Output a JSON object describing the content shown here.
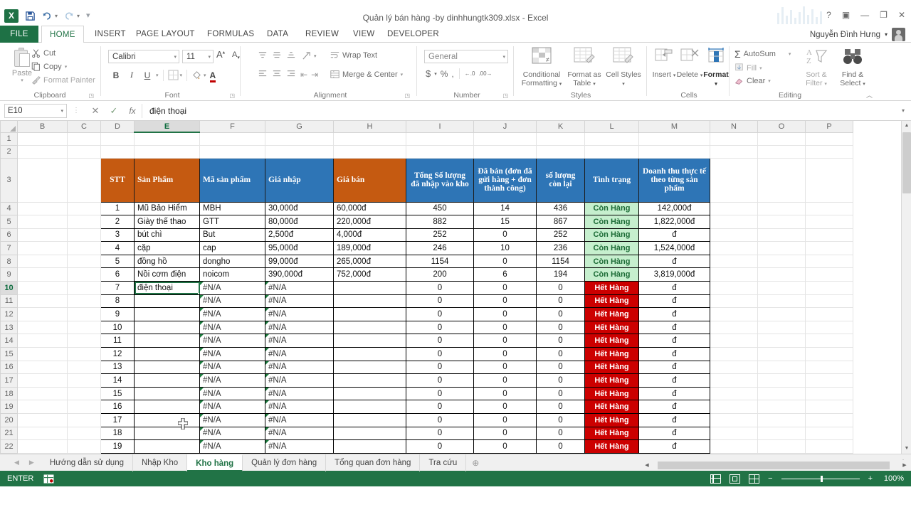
{
  "window": {
    "title": "Quản lý bán hàng -by dinhhungtk309.xlsx - Excel",
    "help": "?",
    "ribbon_display": "▣",
    "minimize": "—",
    "restore": "❐",
    "close": "✕",
    "user_name": "Nguyễn Đình Hưng",
    "user_caret": "▾"
  },
  "qat": {
    "save": "💾",
    "undo": "↰",
    "redo": "↱",
    "more": "▾"
  },
  "ribbon_tabs": [
    {
      "label": "FILE"
    },
    {
      "label": "HOME"
    },
    {
      "label": "INSERT"
    },
    {
      "label": "PAGE LAYOUT"
    },
    {
      "label": "FORMULAS"
    },
    {
      "label": "DATA"
    },
    {
      "label": "REVIEW"
    },
    {
      "label": "VIEW"
    },
    {
      "label": "DEVELOPER"
    }
  ],
  "ribbon": {
    "clipboard": {
      "group_label": "Clipboard",
      "paste": "Paste",
      "paste_caret": "▾",
      "cut": "Cut",
      "copy": "Copy",
      "copy_caret": "▾",
      "format_painter": "Format Painter"
    },
    "font": {
      "group_label": "Font",
      "font_name": "Calibri",
      "font_size": "11",
      "grow": "A",
      "shrink": "A",
      "bold": "B",
      "italic": "I",
      "underline": "U",
      "borders": "▦",
      "fill_color": "◔",
      "font_color": "A",
      "caret": "▾"
    },
    "alignment": {
      "group_label": "Alignment",
      "wrap_text": "Wrap Text",
      "merge_center": "Merge & Center",
      "merge_caret": "▾",
      "orientation": "↗",
      "decrease_indent": "⇤",
      "increase_indent": "⇥"
    },
    "number": {
      "group_label": "Number",
      "format": "General",
      "currency": "$",
      "percent": "%",
      "comma": ",",
      "increase_decimal": "←.0",
      "decrease_decimal": ".00→",
      "caret": "▾"
    },
    "styles": {
      "group_label": "Styles",
      "conditional_formatting": "Conditional Formatting",
      "format_as_table": "Format as Table",
      "cell_styles": "Cell Styles",
      "caret": "▾"
    },
    "cells": {
      "group_label": "Cells",
      "insert": "Insert",
      "delete": "Delete",
      "format": "Format",
      "caret": "▾"
    },
    "editing": {
      "group_label": "Editing",
      "autosum": "AutoSum",
      "fill": "Fill",
      "clear": "Clear",
      "sort_filter": "Sort & Filter",
      "find_select": "Find & Select",
      "caret": "▾",
      "collapse": "︿"
    }
  },
  "formula_bar": {
    "name_box": "E10",
    "name_caret": "▾",
    "cancel": "✕",
    "enter": "✓",
    "fx": "fx",
    "value": "điện thoại",
    "expand": "▾"
  },
  "grid": {
    "columns": [
      "B",
      "C",
      "D",
      "E",
      "F",
      "G",
      "H",
      "I",
      "J",
      "K",
      "L",
      "M",
      "N",
      "O",
      "P"
    ],
    "selected_column": "E",
    "selected_row": "10",
    "rows": [
      "1",
      "2",
      "3",
      "4",
      "5",
      "6",
      "7",
      "8",
      "9",
      "10",
      "11",
      "12",
      "13",
      "14",
      "15",
      "16",
      "17",
      "18",
      "19",
      "20",
      "21",
      "22"
    ],
    "table_headers": [
      {
        "text": "STT",
        "color": "orange",
        "align": "ctr"
      },
      {
        "text": "Sản Phẩm",
        "color": "orange",
        "align": "left"
      },
      {
        "text": "Mã sản phẩm",
        "color": "blue",
        "align": "left"
      },
      {
        "text": "Giá nhập",
        "color": "blue",
        "align": "left"
      },
      {
        "text": "Giá bán",
        "color": "orange",
        "align": "left"
      },
      {
        "text": "Tổng Số lượng đã nhập vào kho",
        "color": "blue",
        "align": "ctr"
      },
      {
        "text": "Đã bán (đơn đã gửi hàng + đơn thành công)",
        "color": "blue",
        "align": "ctr"
      },
      {
        "text": "số lượng còn lại",
        "color": "blue",
        "align": "ctr"
      },
      {
        "text": "Tình trạng",
        "color": "blue",
        "align": "ctr"
      },
      {
        "text": "Doanh thu thực tế theo từng sản phẩm",
        "color": "blue",
        "align": "ctr"
      }
    ],
    "table_rows": [
      {
        "stt": "1",
        "san_pham": "Mũ Bảo Hiểm",
        "ma": "MBH",
        "gia_nhap": "30,000đ",
        "gia_ban": "60,000đ",
        "tong": "450",
        "da_ban": "14",
        "con_lai": "436",
        "tinh_trang": "Còn Hàng",
        "trang_thai_mau": "green",
        "doanh_thu": "142,000đ"
      },
      {
        "stt": "2",
        "san_pham": "Giày thế thao",
        "ma": "GTT",
        "gia_nhap": "80,000đ",
        "gia_ban": "220,000đ",
        "tong": "882",
        "da_ban": "15",
        "con_lai": "867",
        "tinh_trang": "Còn Hàng",
        "trang_thai_mau": "green",
        "doanh_thu": "1,822,000đ"
      },
      {
        "stt": "3",
        "san_pham": "bút chì",
        "ma": "But",
        "gia_nhap": "2,500đ",
        "gia_ban": "4,000đ",
        "tong": "252",
        "da_ban": "0",
        "con_lai": "252",
        "tinh_trang": "Còn Hàng",
        "trang_thai_mau": "green",
        "doanh_thu": "đ"
      },
      {
        "stt": "4",
        "san_pham": "cặp",
        "ma": "cap",
        "gia_nhap": "95,000đ",
        "gia_ban": "189,000đ",
        "tong": "246",
        "da_ban": "10",
        "con_lai": "236",
        "tinh_trang": "Còn Hàng",
        "trang_thai_mau": "green",
        "doanh_thu": "1,524,000đ"
      },
      {
        "stt": "5",
        "san_pham": "đồng hồ",
        "ma": "dongho",
        "gia_nhap": "99,000đ",
        "gia_ban": "265,000đ",
        "tong": "1154",
        "da_ban": "0",
        "con_lai": "1154",
        "tinh_trang": "Còn Hàng",
        "trang_thai_mau": "green",
        "doanh_thu": "đ"
      },
      {
        "stt": "6",
        "san_pham": "Nồi cơm điện",
        "ma": "noicom",
        "gia_nhap": "390,000đ",
        "gia_ban": "752,000đ",
        "tong": "200",
        "da_ban": "6",
        "con_lai": "194",
        "tinh_trang": "Còn Hàng",
        "trang_thai_mau": "green",
        "doanh_thu": "3,819,000đ"
      },
      {
        "stt": "7",
        "san_pham": "điện thoại",
        "ma": "#N/A",
        "gia_nhap": "#N/A",
        "gia_ban": "",
        "tong": "0",
        "da_ban": "0",
        "con_lai": "0",
        "tinh_trang": "Hết Hàng",
        "trang_thai_mau": "red",
        "doanh_thu": "đ"
      },
      {
        "stt": "8",
        "san_pham": "",
        "ma": "#N/A",
        "gia_nhap": "#N/A",
        "gia_ban": "",
        "tong": "0",
        "da_ban": "0",
        "con_lai": "0",
        "tinh_trang": "Hết Hàng",
        "trang_thai_mau": "red",
        "doanh_thu": "đ"
      },
      {
        "stt": "9",
        "san_pham": "",
        "ma": "#N/A",
        "gia_nhap": "#N/A",
        "gia_ban": "",
        "tong": "0",
        "da_ban": "0",
        "con_lai": "0",
        "tinh_trang": "Hết Hàng",
        "trang_thai_mau": "red",
        "doanh_thu": "đ"
      },
      {
        "stt": "10",
        "san_pham": "",
        "ma": "#N/A",
        "gia_nhap": "#N/A",
        "gia_ban": "",
        "tong": "0",
        "da_ban": "0",
        "con_lai": "0",
        "tinh_trang": "Hết Hàng",
        "trang_thai_mau": "red",
        "doanh_thu": "đ"
      },
      {
        "stt": "11",
        "san_pham": "",
        "ma": "#N/A",
        "gia_nhap": "#N/A",
        "gia_ban": "",
        "tong": "0",
        "da_ban": "0",
        "con_lai": "0",
        "tinh_trang": "Hết Hàng",
        "trang_thai_mau": "red",
        "doanh_thu": "đ"
      },
      {
        "stt": "12",
        "san_pham": "",
        "ma": "#N/A",
        "gia_nhap": "#N/A",
        "gia_ban": "",
        "tong": "0",
        "da_ban": "0",
        "con_lai": "0",
        "tinh_trang": "Hết Hàng",
        "trang_thai_mau": "red",
        "doanh_thu": "đ"
      },
      {
        "stt": "13",
        "san_pham": "",
        "ma": "#N/A",
        "gia_nhap": "#N/A",
        "gia_ban": "",
        "tong": "0",
        "da_ban": "0",
        "con_lai": "0",
        "tinh_trang": "Hết Hàng",
        "trang_thai_mau": "red",
        "doanh_thu": "đ"
      },
      {
        "stt": "14",
        "san_pham": "",
        "ma": "#N/A",
        "gia_nhap": "#N/A",
        "gia_ban": "",
        "tong": "0",
        "da_ban": "0",
        "con_lai": "0",
        "tinh_trang": "Hết Hàng",
        "trang_thai_mau": "red",
        "doanh_thu": "đ"
      },
      {
        "stt": "15",
        "san_pham": "",
        "ma": "#N/A",
        "gia_nhap": "#N/A",
        "gia_ban": "",
        "tong": "0",
        "da_ban": "0",
        "con_lai": "0",
        "tinh_trang": "Hết Hàng",
        "trang_thai_mau": "red",
        "doanh_thu": "đ"
      },
      {
        "stt": "16",
        "san_pham": "",
        "ma": "#N/A",
        "gia_nhap": "#N/A",
        "gia_ban": "",
        "tong": "0",
        "da_ban": "0",
        "con_lai": "0",
        "tinh_trang": "Hết Hàng",
        "trang_thai_mau": "red",
        "doanh_thu": "đ"
      },
      {
        "stt": "17",
        "san_pham": "",
        "ma": "#N/A",
        "gia_nhap": "#N/A",
        "gia_ban": "",
        "tong": "0",
        "da_ban": "0",
        "con_lai": "0",
        "tinh_trang": "Hết Hàng",
        "trang_thai_mau": "red",
        "doanh_thu": "đ"
      },
      {
        "stt": "18",
        "san_pham": "",
        "ma": "#N/A",
        "gia_nhap": "#N/A",
        "gia_ban": "",
        "tong": "0",
        "da_ban": "0",
        "con_lai": "0",
        "tinh_trang": "Hết Hàng",
        "trang_thai_mau": "red",
        "doanh_thu": "đ"
      },
      {
        "stt": "19",
        "san_pham": "",
        "ma": "#N/A",
        "gia_nhap": "#N/A",
        "gia_ban": "",
        "tong": "0",
        "da_ban": "0",
        "con_lai": "0",
        "tinh_trang": "Hết Hàng",
        "trang_thai_mau": "red",
        "doanh_thu": "đ"
      }
    ]
  },
  "sheet_tabs": {
    "prev": "◀",
    "next": "▶",
    "add": "⊕",
    "items": [
      {
        "label": "Hướng dẫn sử dụng",
        "active": false
      },
      {
        "label": "Nhập Kho",
        "active": false
      },
      {
        "label": "Kho hàng",
        "active": true
      },
      {
        "label": "Quản lý đơn hàng",
        "active": false
      },
      {
        "label": "Tổng quan đơn hàng",
        "active": false
      },
      {
        "label": "Tra cứu",
        "active": false
      }
    ]
  },
  "status_bar": {
    "mode": "ENTER",
    "macro_icon": "▤",
    "view_normal": "normal-view",
    "view_page_layout": "page-layout-view",
    "view_page_break": "page-break-view",
    "zoom_out": "−",
    "zoom_in": "+",
    "zoom": "100%"
  },
  "colors": {
    "excel_green": "#217346",
    "header_orange": "#c55a11",
    "header_blue": "#2e75b6",
    "status_green_bg": "#c6efce",
    "status_red_bg": "#cc0000"
  }
}
